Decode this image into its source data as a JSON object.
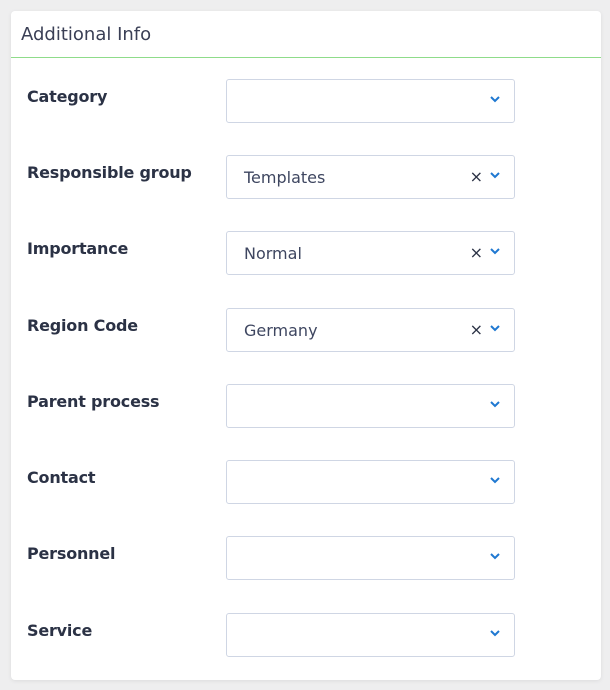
{
  "header": {
    "title": "Additional Info"
  },
  "colors": {
    "accent": "#1f78d1",
    "header_border": "#8fdc8a"
  },
  "fields": [
    {
      "label": "Category",
      "value": "",
      "clearable": false
    },
    {
      "label": "Responsible group",
      "value": "Templates",
      "clearable": true
    },
    {
      "label": "Importance",
      "value": "Normal",
      "clearable": true
    },
    {
      "label": "Region Code",
      "value": "Germany",
      "clearable": true
    },
    {
      "label": "Parent process",
      "value": "",
      "clearable": false
    },
    {
      "label": "Contact",
      "value": "",
      "clearable": false
    },
    {
      "label": "Personnel",
      "value": "",
      "clearable": false
    },
    {
      "label": "Service",
      "value": "",
      "clearable": false
    }
  ],
  "icons": {
    "clear": "×",
    "chevron": "chevron-down-icon"
  }
}
